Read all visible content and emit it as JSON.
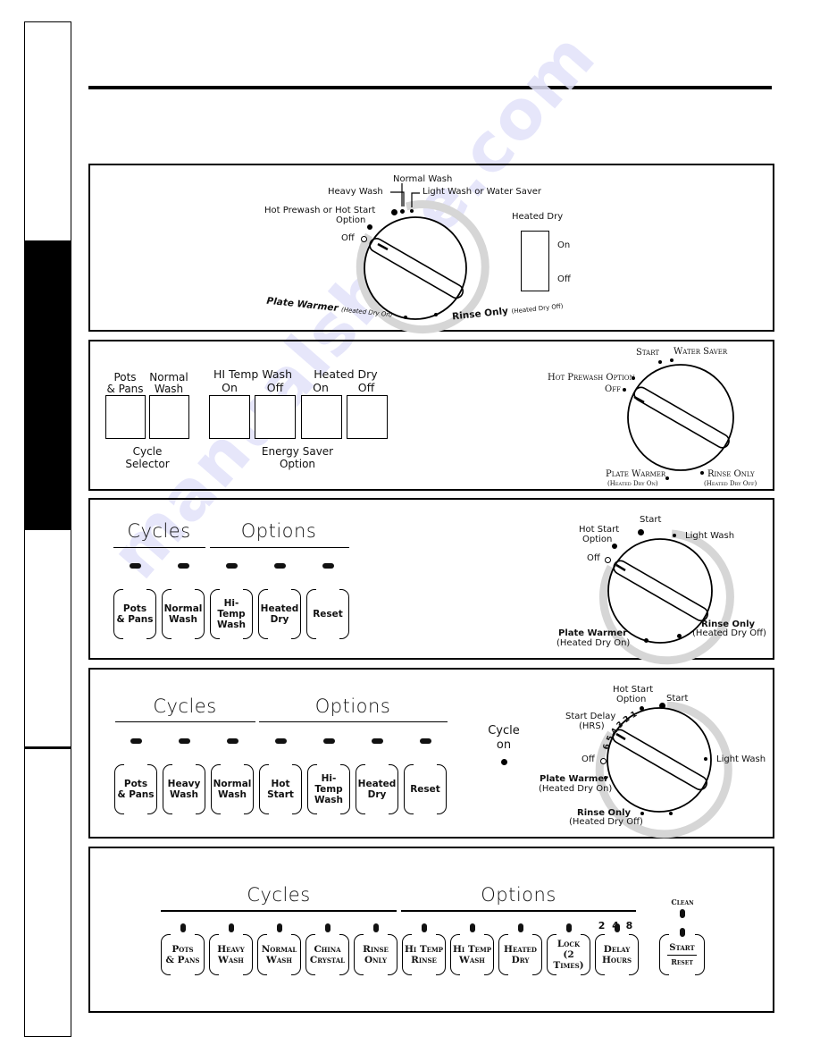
{
  "watermark": "manualshive.com",
  "panel1": {
    "dial_labels": {
      "normal_wash": "Normal Wash",
      "heavy_wash": "Heavy Wash",
      "light_wash": "Light Wash or Water Saver",
      "hot_prewash": "Hot Prewash or Hot Start",
      "hot_prewash_2": "Option",
      "off": "Off",
      "plate_warmer": "Plate Warmer",
      "plate_warmer_sub": "(Heated Dry On)",
      "rinse_only": "Rinse Only",
      "rinse_only_sub": "(Heated Dry Off)"
    },
    "switch": {
      "title": "Heated Dry",
      "on": "On",
      "off": "Off"
    }
  },
  "panel2": {
    "cycle_buttons": [
      {
        "top": "Pots",
        "bottom": "& Pans"
      },
      {
        "top": "Normal",
        "bottom": "Wash"
      }
    ],
    "cycle_caption": [
      "Cycle",
      "Selector"
    ],
    "hi_temp_title": "HI Temp Wash",
    "heated_dry_title": "Heated Dry",
    "energy_buttons": [
      "On",
      "Off",
      "On",
      "Off"
    ],
    "energy_caption": [
      "Energy Saver",
      "Option"
    ],
    "dial_labels": {
      "start": "Start",
      "water_saver": "Water Saver",
      "hot_prewash": "Hot Prewash Option",
      "off": "Off",
      "plate_warmer": "Plate Warmer",
      "plate_warmer_sub": "(Heated Dry On)",
      "rinse_only": "Rinse Only",
      "rinse_only_sub": "(Heated Dry Off)"
    }
  },
  "panel3": {
    "cycles_title": "Cycles",
    "options_title": "Options",
    "buttons": [
      {
        "line1": "Pots",
        "line2": "& Pans"
      },
      {
        "line1": "Normal",
        "line2": "Wash"
      },
      {
        "line1": "Hi-Temp",
        "line2": "Wash"
      },
      {
        "line1": "Heated",
        "line2": "Dry"
      },
      {
        "line1": "Reset",
        "line2": ""
      }
    ],
    "dial_labels": {
      "start": "Start",
      "hot_start": "Hot Start",
      "hot_start_2": "Option",
      "light_wash": "Light Wash",
      "off": "Off",
      "plate_warmer": "Plate Warmer",
      "plate_warmer_sub": "(Heated Dry On)",
      "rinse_only": "Rinse Only",
      "rinse_only_sub": "(Heated Dry Off)"
    }
  },
  "panel4": {
    "cycles_title": "Cycles",
    "options_title": "Options",
    "buttons": [
      {
        "line1": "Pots",
        "line2": "& Pans"
      },
      {
        "line1": "Heavy",
        "line2": "Wash"
      },
      {
        "line1": "Normal",
        "line2": "Wash"
      },
      {
        "line1": "Hot",
        "line2": "Start"
      },
      {
        "line1": "Hi-Temp",
        "line2": "Wash"
      },
      {
        "line1": "Heated",
        "line2": "Dry"
      },
      {
        "line1": "Reset",
        "line2": ""
      }
    ],
    "cycle_on": [
      "Cycle",
      "on"
    ],
    "dial_labels": {
      "hot_start": "Hot Start",
      "hot_start_2": "Option",
      "start": "Start",
      "start_delay": "Start Delay",
      "start_delay_2": "(HRS)",
      "delay_numbers": [
        "1",
        "2",
        "3",
        "4",
        "5",
        "6"
      ],
      "off": "Off",
      "light_wash": "Light Wash",
      "plate_warmer": "Plate Warmer",
      "plate_warmer_sub": "(Heated Dry On)",
      "rinse_only": "Rinse Only",
      "rinse_only_sub": "(Heated Dry Off)"
    }
  },
  "panel5": {
    "cycles_title": "Cycles",
    "options_title": "Options",
    "buttons": [
      {
        "line1": "Pots",
        "line2": "& Pans"
      },
      {
        "line1": "Heavy",
        "line2": "Wash"
      },
      {
        "line1": "Normal",
        "line2": "Wash"
      },
      {
        "line1": "China",
        "line2": "Crystal"
      },
      {
        "line1": "Rinse",
        "line2": "Only"
      },
      {
        "line1": "Hi Temp",
        "line2": "Rinse"
      },
      {
        "line1": "Hi Temp",
        "line2": "Wash"
      },
      {
        "line1": "Heated",
        "line2": "Dry"
      },
      {
        "line1": "Lock",
        "line2": "(2 Times)"
      },
      {
        "line1": "Delay",
        "line2": "Hours"
      }
    ],
    "delay_values": "2  4  8",
    "clean_label": "Clean",
    "start_label": "Start",
    "reset_label": "Reset"
  }
}
